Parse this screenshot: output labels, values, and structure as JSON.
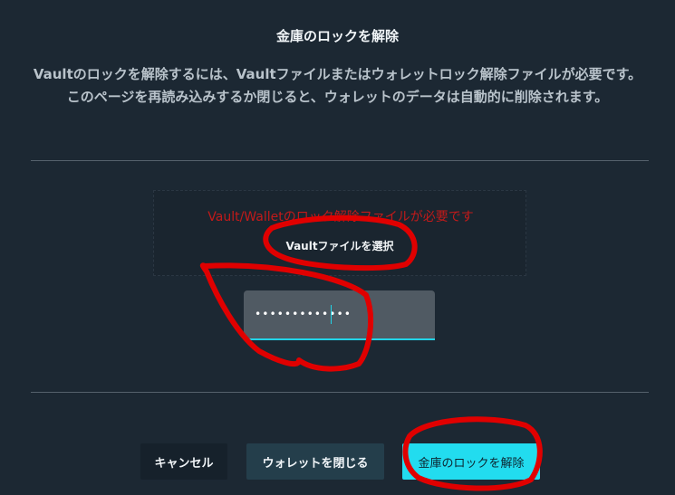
{
  "dialog": {
    "title": "金庫のロックを解除",
    "description": "Vaultのロックを解除するには、Vaultファイルまたはウォレットロック解除ファイルが必要です。このページを再読み込みするか閉じると、ウォレットのデータは自動的に削除されます。"
  },
  "file_panel": {
    "required_text": "Vault/Walletのロック解除ファイルが必要です",
    "select_button_label": "Vaultファイルを選択"
  },
  "password": {
    "value": "•••••••••••••"
  },
  "buttons": {
    "cancel": "キャンセル",
    "close_wallet": "ウォレットを閉じる",
    "unlock": "金庫のロックを解除"
  },
  "colors": {
    "background": "#1c2833",
    "accent": "#22dcef",
    "error_text": "#c21a1a",
    "annotation": "#e00000"
  }
}
